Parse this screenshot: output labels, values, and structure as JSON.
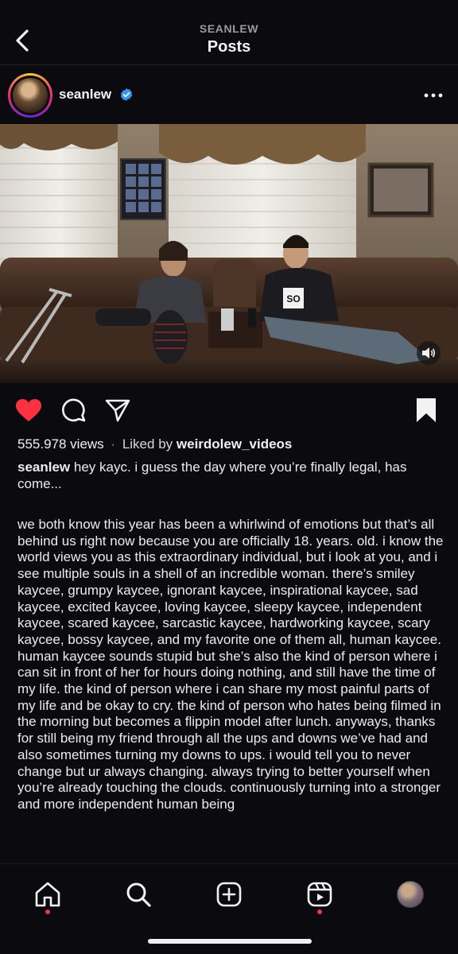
{
  "header": {
    "username": "SEANLEW",
    "title": "Posts"
  },
  "author": {
    "name": "seanlew",
    "verified": true,
    "icons": [
      "back-arrow-icon",
      "verified-badge-icon",
      "more-dots-icon"
    ]
  },
  "video": {
    "poster_shirt_text": "SO",
    "muted_icon": "speaker-icon"
  },
  "actions": {
    "liked": true,
    "like_color": "#ff3040",
    "icons": [
      "heart-icon",
      "comment-icon",
      "share-icon",
      "bookmark-icon"
    ]
  },
  "meta": {
    "views": "555.978 views",
    "liked_by_prefix": "Liked by",
    "liked_by_user": "weirdolew_videos"
  },
  "caption": {
    "username": "seanlew",
    "intro": "hey kayc. i guess the day where you’re finally legal, has come...",
    "body": "we both know this year has been a whirlwind of emotions but that’s all behind us right now because you are officially 18. years. old. i know the world views you as this extraordinary individual, but i look at you, and i see multiple souls in a shell of an incredible woman. there’s smiley kaycee, grumpy kaycee, ignorant kaycee, inspirational kaycee, sad kaycee, excited kaycee, loving kaycee, sleepy kaycee, independent kaycee, scared kaycee, sarcastic kaycee, hardworking kaycee, scary kaycee, bossy kaycee, and my favorite one of them all, human kaycee.\nhuman kaycee sounds stupid but she’s also the kind of person where i can sit in front of her for hours doing nothing, and still have the time of my life. the kind of person where i can share my most painful parts of my life and be okay to cry. the kind of person who hates being filmed in the morning but becomes a flippin model after lunch. anyways, thanks for still being my friend through all the ups and downs we’ve had and also sometimes turning my downs to ups. i would tell you to never change but ur always changing. always trying to better yourself when you’re already touching the clouds. continuously turning into a stronger and more independent human being"
  },
  "bottom_nav": {
    "items": [
      "home-icon",
      "search-icon",
      "create-icon",
      "reels-icon",
      "profile-icon"
    ],
    "notification_dot_color": "#ff3040"
  }
}
